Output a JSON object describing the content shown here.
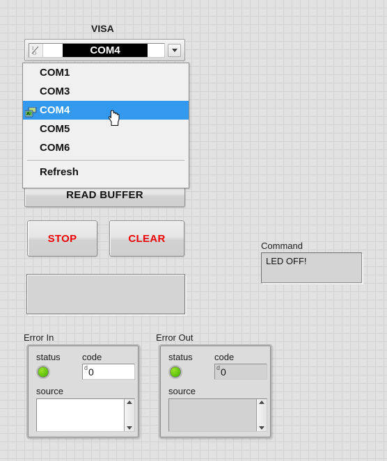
{
  "panel": {
    "background_color": "#e2e2e2",
    "grid_color": "#d2d2d2"
  },
  "visa": {
    "title": "VISA",
    "selected_value": "COM4",
    "io_glyph": "I/O",
    "dropdown_open": true,
    "items": [
      {
        "label": "COM1",
        "selected": false,
        "has_icon": false
      },
      {
        "label": "COM3",
        "selected": false,
        "has_icon": false
      },
      {
        "label": "COM4",
        "selected": true,
        "has_icon": true
      },
      {
        "label": "COM5",
        "selected": false,
        "has_icon": false
      },
      {
        "label": "COM6",
        "selected": false,
        "has_icon": false
      }
    ],
    "refresh_label": "Refresh",
    "highlight_color": "#3399ef"
  },
  "controls": {
    "read_buffer_label": "READ BUFFER",
    "stop_label": "STOP",
    "clear_label": "CLEAR",
    "button_text_color": "#ee0000"
  },
  "buffer_display": {
    "value": ""
  },
  "command": {
    "label": "Command",
    "value": "LED OFF!"
  },
  "error_in": {
    "label": "Error In",
    "status_label": "status",
    "status_color": "#63c60d",
    "code_label": "code",
    "code_radix": "d",
    "code_value": "0",
    "source_label": "source",
    "source_value": ""
  },
  "error_out": {
    "label": "Error Out",
    "status_label": "status",
    "status_color": "#63c60d",
    "code_label": "code",
    "code_radix": "d",
    "code_value": "0",
    "source_label": "source",
    "source_value": ""
  },
  "cursor": {
    "icon": "pointing-hand-cursor"
  }
}
